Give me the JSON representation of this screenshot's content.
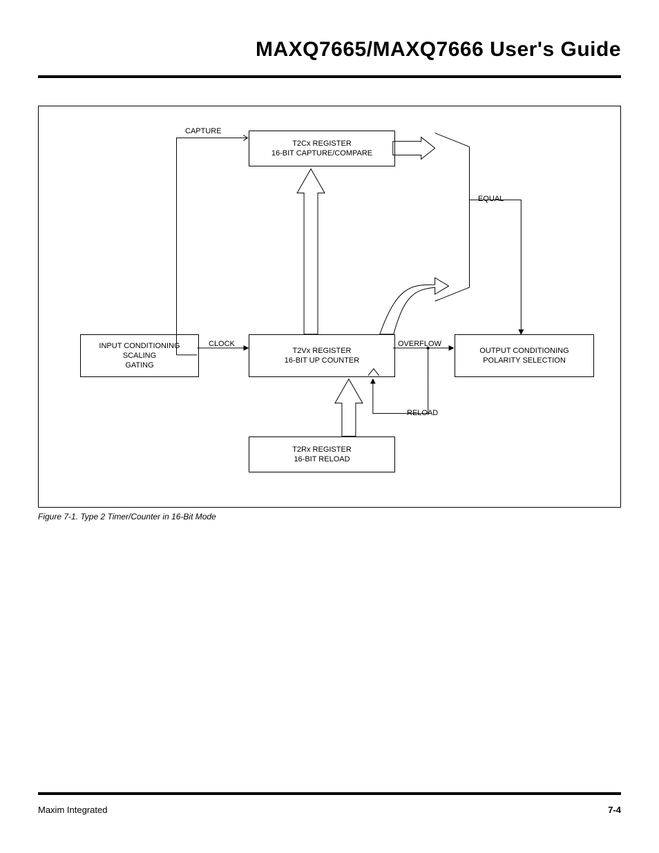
{
  "title": "MAXQ7665/MAXQ7666 User's Guide",
  "figure": {
    "caption": "Figure 7-1. Type 2 Timer/Counter in 16-Bit Mode",
    "labels": {
      "capture": "CAPTURE",
      "clock": "CLOCK",
      "overflow": "OVERFLOW",
      "equal": "EQUAL",
      "reload": "RELOAD"
    },
    "boxes": {
      "t2cx_l1": "T2Cx REGISTER",
      "t2cx_l2": "16-BIT CAPTURE/COMPARE",
      "input_l1": "INPUT CONDITIONING",
      "input_l2": "SCALING",
      "input_l3": "GATING",
      "t2vx_l1": "T2Vx REGISTER",
      "t2vx_l2": "16-BIT UP COUNTER",
      "output_l1": "OUTPUT CONDITIONING",
      "output_l2": "POLARITY SELECTION",
      "t2rx_l1": "T2Rx REGISTER",
      "t2rx_l2": "16-BIT RELOAD"
    }
  },
  "footer": {
    "left": "Maxim Integrated",
    "right": "7-4"
  }
}
